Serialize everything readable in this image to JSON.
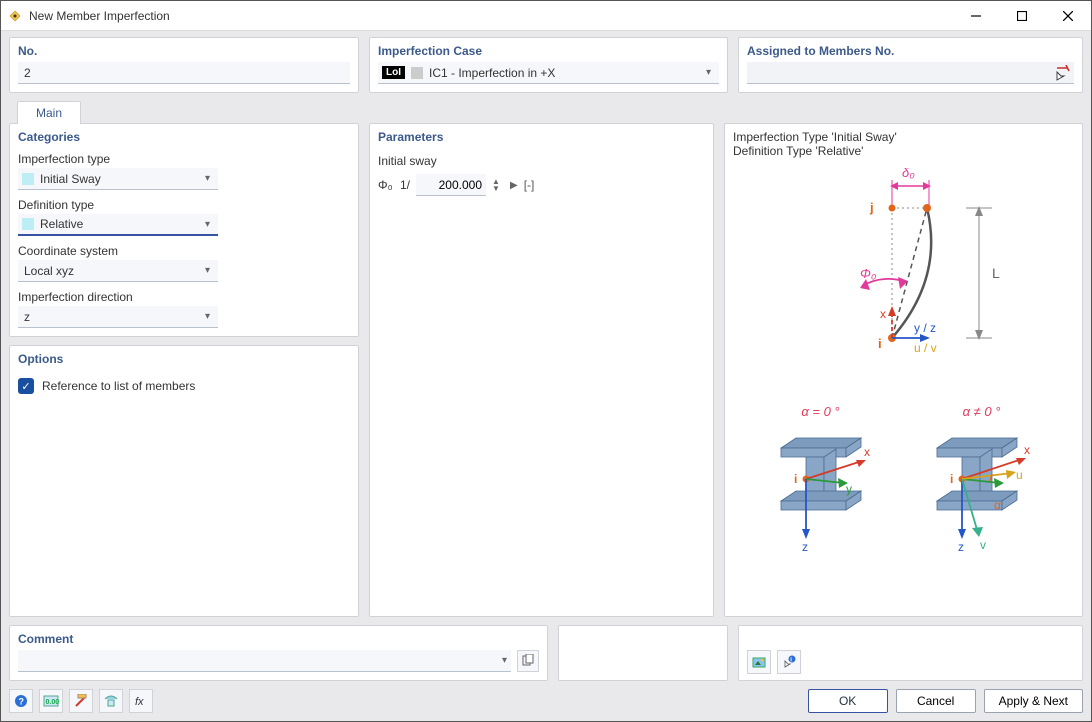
{
  "window": {
    "title": "New Member Imperfection"
  },
  "top": {
    "no_label": "No.",
    "no_value": "2",
    "case_label": "Imperfection Case",
    "case_chip": "LoI",
    "case_value": "IC1 - Imperfection in +X",
    "assign_label": "Assigned to Members No.",
    "assign_value": ""
  },
  "tabs": {
    "main": "Main"
  },
  "categories": {
    "title": "Categories",
    "type_label": "Imperfection type",
    "type_value": "Initial Sway",
    "def_label": "Definition type",
    "def_value": "Relative",
    "coord_label": "Coordinate system",
    "coord_value": "Local xyz",
    "dir_label": "Imperfection direction",
    "dir_value": "z"
  },
  "options": {
    "title": "Options",
    "ref_label": "Reference to list of members",
    "ref_checked": true
  },
  "params": {
    "title": "Parameters",
    "initial_sway_label": "Initial sway",
    "symbol": "Φ₀",
    "prefix": "1/",
    "value": "200.000",
    "unit": "[-]"
  },
  "preview": {
    "line1": "Imperfection Type 'Initial Sway'",
    "line2": "Definition Type 'Relative'",
    "labels": {
      "delta0": "δ₀",
      "phi0": "Φ₀",
      "L": "L",
      "j": "j",
      "i": "i",
      "x": "x",
      "y_z": "y / z",
      "u_v": "u / v",
      "alpha_eq": "α = 0 °",
      "alpha_ne": "α ≠ 0 °",
      "y": "y",
      "z": "z",
      "u": "u",
      "v": "v",
      "alpha": "α"
    }
  },
  "comment": {
    "title": "Comment",
    "value": ""
  },
  "buttons": {
    "ok": "OK",
    "cancel": "Cancel",
    "apply_next": "Apply & Next"
  }
}
